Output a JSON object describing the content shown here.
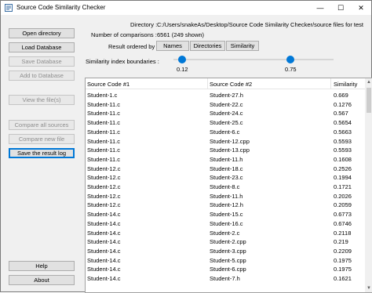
{
  "window": {
    "title": "Source Code Similarity Checker",
    "minimize": "—",
    "maximize": "☐",
    "close": "✕"
  },
  "sidebar": {
    "open_directory": "Open directory",
    "load_database": "Load Database",
    "save_database": "Save Database",
    "add_to_database": "Add to Database",
    "view_files": "View the file(s)",
    "compare_all": "Compare all sources",
    "compare_new": "Compare new file",
    "save_log": "Save the result log",
    "help": "Help",
    "about": "About"
  },
  "info": {
    "directory_label": "Directory :",
    "directory_value": "C:/Users/snakeAs/Desktop/Source Code Similarity Checker/source files for test",
    "comparisons_label": "Number of comparisons :",
    "comparisons_value": "6561 (249 shown)",
    "ordered_label": "Result ordered by :",
    "order_buttons": [
      "Names",
      "Directories",
      "Similarity"
    ]
  },
  "slider": {
    "label": "Similarity index boundaries :",
    "low": "0.12",
    "high": "0.75",
    "low_fraction": 0.12,
    "high_fraction": 0.75
  },
  "table": {
    "columns": [
      "Source Code #1",
      "Source Code #2",
      "Similarity"
    ],
    "rows": [
      [
        "Student-1.c",
        "Student-27.h",
        "0.669"
      ],
      [
        "Student-11.c",
        "Student-22.c",
        "0.1276"
      ],
      [
        "Student-11.c",
        "Student-24.c",
        "0.567"
      ],
      [
        "Student-11.c",
        "Student-25.c",
        "0.5654"
      ],
      [
        "Student-11.c",
        "Student-6.c",
        "0.5663"
      ],
      [
        "Student-11.c",
        "Student-12.cpp",
        "0.5593"
      ],
      [
        "Student-11.c",
        "Student-13.cpp",
        "0.5593"
      ],
      [
        "Student-11.c",
        "Student-11.h",
        "0.1608"
      ],
      [
        "Student-12.c",
        "Student-18.c",
        "0.2526"
      ],
      [
        "Student-12.c",
        "Student-23.c",
        "0.1994"
      ],
      [
        "Student-12.c",
        "Student-8.c",
        "0.1721"
      ],
      [
        "Student-12.c",
        "Student-11.h",
        "0.2026"
      ],
      [
        "Student-12.c",
        "Student-12.h",
        "0.2059"
      ],
      [
        "Student-14.c",
        "Student-15.c",
        "0.6773"
      ],
      [
        "Student-14.c",
        "Student-16.c",
        "0.6746"
      ],
      [
        "Student-14.c",
        "Student-2.c",
        "0.2118"
      ],
      [
        "Student-14.c",
        "Student-2.cpp",
        "0.219"
      ],
      [
        "Student-14.c",
        "Student-3.cpp",
        "0.2209"
      ],
      [
        "Student-14.c",
        "Student-5.cpp",
        "0.1975"
      ],
      [
        "Student-14.c",
        "Student-6.cpp",
        "0.1975"
      ],
      [
        "Student-14.c",
        "Student-7.h",
        "0.1621"
      ]
    ]
  }
}
